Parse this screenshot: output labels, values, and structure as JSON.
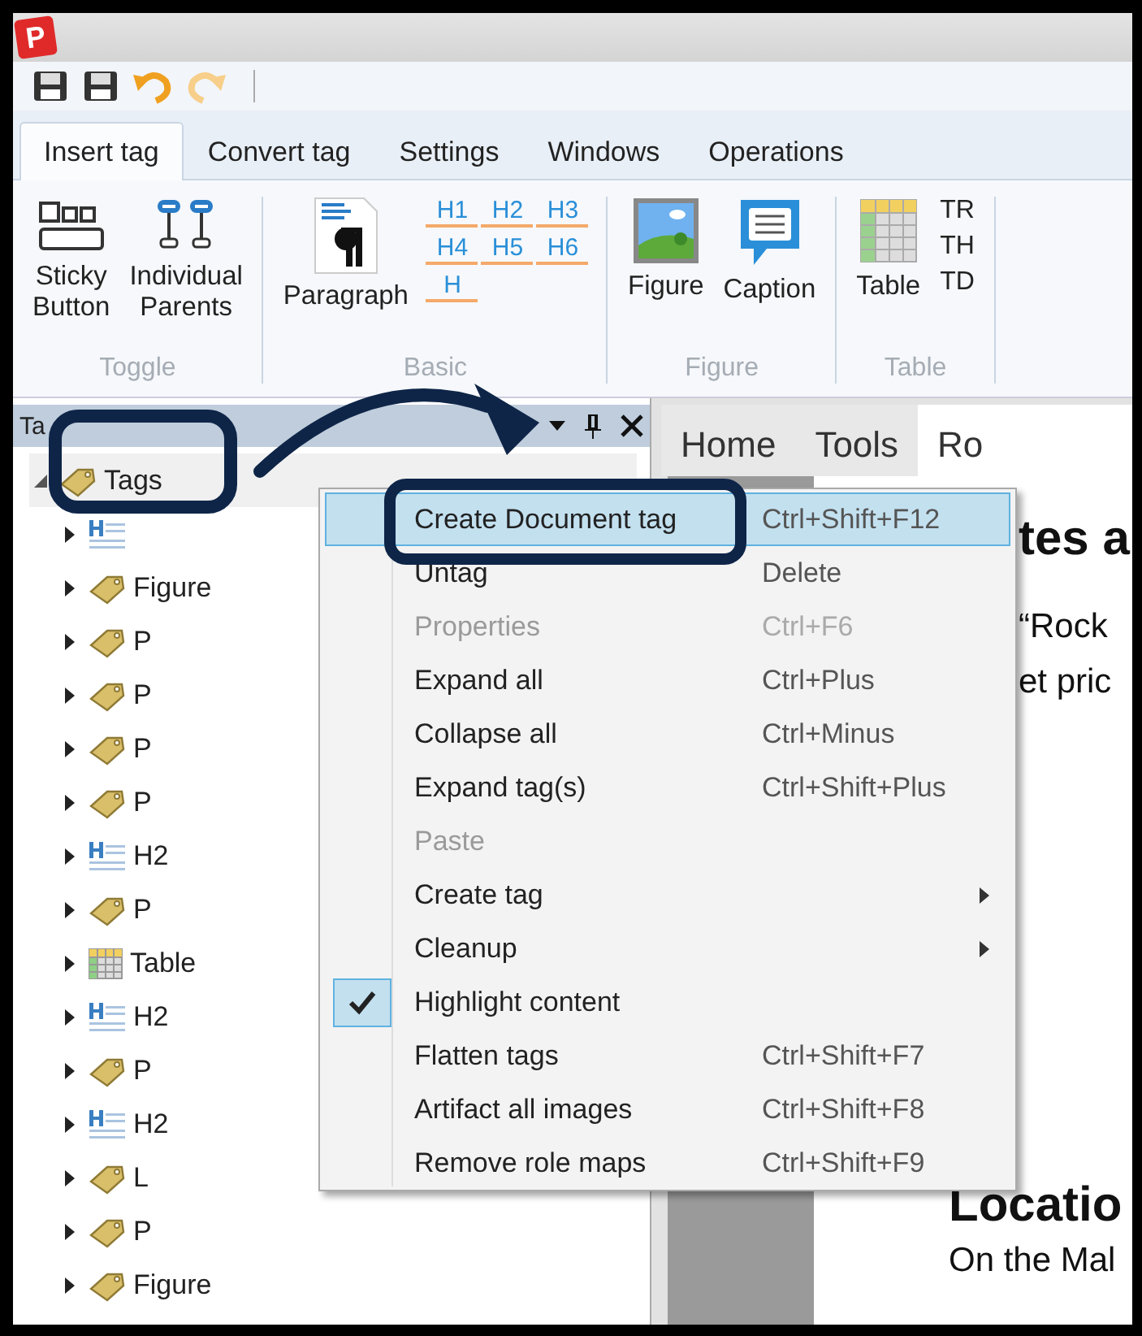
{
  "app_logo": "P",
  "quick_access": [
    {
      "kind": "save"
    },
    {
      "kind": "save"
    },
    {
      "kind": "undo"
    },
    {
      "kind": "redo"
    }
  ],
  "ribbon": {
    "tabs": [
      {
        "label": "Insert tag",
        "selected": true
      },
      {
        "label": "Convert tag",
        "selected": false
      },
      {
        "label": "Settings",
        "selected": false
      },
      {
        "label": "Windows",
        "selected": false
      },
      {
        "label": "Operations",
        "selected": false
      }
    ],
    "groups": [
      {
        "label": "Toggle",
        "items": [
          {
            "kind": "sticky",
            "label": "Sticky Button"
          },
          {
            "kind": "parents",
            "label": "Individual Parents"
          }
        ]
      },
      {
        "label": "Basic",
        "items": [
          {
            "kind": "paragraph",
            "label": "Paragraph"
          },
          {
            "kind": "headings",
            "labels": [
              "H1",
              "H2",
              "H3",
              "H4",
              "H5",
              "H6",
              "H"
            ]
          }
        ]
      },
      {
        "label": "Figure",
        "items": [
          {
            "kind": "figure",
            "label": "Figure"
          },
          {
            "kind": "caption",
            "label": "Caption"
          }
        ]
      },
      {
        "label": "Table",
        "items": [
          {
            "kind": "table",
            "label": "Table"
          },
          {
            "kind": "stack",
            "labels": [
              "TR",
              "TH",
              "TD"
            ]
          }
        ]
      }
    ]
  },
  "tags_pane": {
    "title": "Ta",
    "tree": [
      {
        "label": "Tags",
        "kind": "tag",
        "expanded": true,
        "selected": true,
        "children": [
          {
            "kind": "heading",
            "expanded": false,
            "selected": false
          },
          {
            "label": "Figure",
            "kind": "tag",
            "expanded": false,
            "selected": false
          },
          {
            "label": "P",
            "kind": "tag",
            "expanded": false,
            "selected": false
          },
          {
            "label": "P",
            "kind": "tag",
            "expanded": false,
            "selected": false
          },
          {
            "label": "P",
            "kind": "tag",
            "expanded": false,
            "selected": false
          },
          {
            "label": "P",
            "kind": "tag",
            "expanded": false,
            "selected": false
          },
          {
            "label": "H2",
            "kind": "heading",
            "expanded": false,
            "selected": false
          },
          {
            "label": "P",
            "kind": "tag",
            "expanded": false,
            "selected": false
          },
          {
            "label": "Table",
            "kind": "table",
            "expanded": false,
            "selected": false
          },
          {
            "label": "H2",
            "kind": "heading",
            "expanded": false,
            "selected": false
          },
          {
            "label": "P",
            "kind": "tag",
            "expanded": false,
            "selected": false
          },
          {
            "label": "H2",
            "kind": "heading",
            "expanded": false,
            "selected": false
          },
          {
            "label": "L",
            "kind": "tag",
            "expanded": false,
            "selected": false
          },
          {
            "label": "P",
            "kind": "tag",
            "expanded": false,
            "selected": false
          },
          {
            "label": "Figure",
            "kind": "tag",
            "expanded": false,
            "selected": false
          }
        ]
      }
    ]
  },
  "document": {
    "tabs": [
      {
        "label": "Home",
        "selected": false
      },
      {
        "label": "Tools",
        "selected": false
      },
      {
        "label": "Ro",
        "selected": true
      }
    ],
    "upper": [
      {
        "kind": "heading",
        "text": "tes a"
      },
      {
        "kind": "para",
        "text": "“Rock"
      },
      {
        "kind": "para",
        "text": "et pric"
      }
    ],
    "lower": [
      {
        "kind": "heading",
        "text": "Locatio"
      },
      {
        "kind": "para",
        "text": "On the Mal"
      }
    ]
  },
  "context_menu": [
    {
      "label": "Create Document tag",
      "shortcut": "Ctrl+Shift+F12",
      "selected": true,
      "disabled": false,
      "checked": false,
      "submenu": false
    },
    {
      "label": "Untag",
      "shortcut": "Delete",
      "selected": false,
      "disabled": false,
      "checked": false,
      "submenu": false
    },
    {
      "label": "Properties",
      "shortcut": "Ctrl+F6",
      "selected": false,
      "disabled": true,
      "checked": false,
      "submenu": false
    },
    {
      "label": "Expand all",
      "shortcut": "Ctrl+Plus",
      "selected": false,
      "disabled": false,
      "checked": false,
      "submenu": false
    },
    {
      "label": "Collapse all",
      "shortcut": "Ctrl+Minus",
      "selected": false,
      "disabled": false,
      "checked": false,
      "submenu": false
    },
    {
      "label": "Expand tag(s)",
      "shortcut": "Ctrl+Shift+Plus",
      "selected": false,
      "disabled": false,
      "checked": false,
      "submenu": false
    },
    {
      "label": "Paste",
      "selected": false,
      "disabled": true,
      "checked": false,
      "submenu": false
    },
    {
      "label": "Create tag",
      "selected": false,
      "disabled": false,
      "checked": false,
      "submenu": true
    },
    {
      "label": "Cleanup",
      "selected": false,
      "disabled": false,
      "checked": false,
      "submenu": true
    },
    {
      "label": "Highlight content",
      "selected": false,
      "disabled": false,
      "checked": true,
      "submenu": false
    },
    {
      "label": "Flatten tags",
      "shortcut": "Ctrl+Shift+F7",
      "selected": false,
      "disabled": false,
      "checked": false,
      "submenu": false
    },
    {
      "label": "Artifact all images",
      "shortcut": "Ctrl+Shift+F8",
      "selected": false,
      "disabled": false,
      "checked": false,
      "submenu": false
    },
    {
      "label": "Remove role maps",
      "shortcut": "Ctrl+Shift+F9",
      "selected": false,
      "disabled": false,
      "checked": false,
      "submenu": false
    }
  ]
}
